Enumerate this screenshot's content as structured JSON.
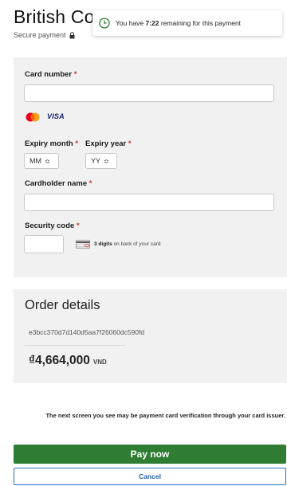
{
  "header": {
    "title": "British Co",
    "secure_label": "Secure payment",
    "lock_icon": "lock-icon"
  },
  "timer": {
    "icon": "clock-icon",
    "prefix": "You have ",
    "time": "7:22",
    "suffix": " remaining for this payment"
  },
  "card_form": {
    "card_number": {
      "label": "Card number",
      "required_mark": "*",
      "value": ""
    },
    "brands": [
      {
        "name": "mastercard",
        "icon": "mastercard-icon"
      },
      {
        "name": "VISA",
        "icon": "visa-icon"
      }
    ],
    "expiry_month": {
      "label": "Expiry month",
      "required_mark": "*",
      "selected": "MM"
    },
    "expiry_year": {
      "label": "Expiry year",
      "required_mark": "*",
      "selected": "YY"
    },
    "cardholder_name": {
      "label": "Cardholder name",
      "required_mark": "*",
      "value": ""
    },
    "security_code": {
      "label": "Security code",
      "required_mark": "*",
      "value": "",
      "hint_bold": "3 digits",
      "hint_rest": " on back of your card",
      "hint_icon": "card-back-icon"
    }
  },
  "order": {
    "title": "Order details",
    "id": "e3bcc370d7d140d5aa7f26060dc590fd",
    "amount": "₫4,664,000",
    "currency": "VND"
  },
  "notice": "The next screen you see may be payment card verification through your card issuer.",
  "actions": {
    "pay_label": "Pay now",
    "cancel_label": "Cancel"
  },
  "colors": {
    "pay_button": "#2e7d32",
    "cancel_border": "#2a6fbf",
    "required": "#c0392b",
    "timer_icon": "#2e7d32"
  }
}
